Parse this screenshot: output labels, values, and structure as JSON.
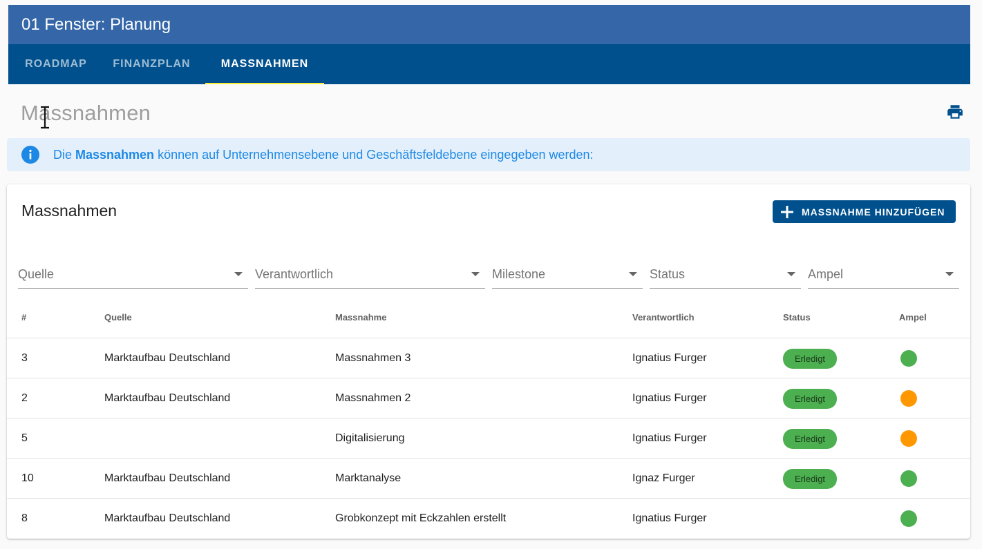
{
  "window": {
    "title": "01 Fenster: Planung"
  },
  "tabs": [
    {
      "label": "ROADMAP"
    },
    {
      "label": "FINANZPLAN"
    },
    {
      "label": "MASSNAHMEN"
    }
  ],
  "page": {
    "title": "Massnahmen"
  },
  "info": {
    "prefix": "Die ",
    "bold": "Massnahmen",
    "suffix": " können auf Unternehmensebene und Geschäftsfeldebene eingegeben werden:"
  },
  "card": {
    "title": "Massnahmen",
    "add_button_label": "MASSNAHME HINZUFÜGEN"
  },
  "filters": [
    {
      "label": "Quelle"
    },
    {
      "label": "Verantwortlich"
    },
    {
      "label": "Milestone"
    },
    {
      "label": "Status"
    },
    {
      "label": "Ampel"
    }
  ],
  "table": {
    "headers": [
      "#",
      "Quelle",
      "Massnahme",
      "Verantwortlich",
      "Status",
      "Ampel"
    ],
    "rows": [
      {
        "nr": "3",
        "quelle": "Marktaufbau Deutschland",
        "massnahme": "Massnahmen 3",
        "verantwortlich": "Ignatius Furger",
        "status": "Erledigt",
        "ampel": "#4caf50"
      },
      {
        "nr": "2",
        "quelle": "Marktaufbau Deutschland",
        "massnahme": "Massnahmen 2",
        "verantwortlich": "Ignatius Furger",
        "status": "Erledigt",
        "ampel": "#ff9800"
      },
      {
        "nr": "5",
        "quelle": "",
        "massnahme": "Digitalisierung",
        "verantwortlich": "Ignatius Furger",
        "status": "Erledigt",
        "ampel": "#ff9800"
      },
      {
        "nr": "10",
        "quelle": "Marktaufbau Deutschland",
        "massnahme": "Marktanalyse",
        "verantwortlich": "Ignaz Furger",
        "status": "Erledigt",
        "ampel": "#4caf50"
      },
      {
        "nr": "8",
        "quelle": "Marktaufbau Deutschland",
        "massnahme": "Grobkonzept mit Eckzahlen erstellt",
        "verantwortlich": "Ignatius Furger",
        "status": "",
        "ampel": "#4caf50"
      }
    ]
  },
  "colors": {
    "header": "#3466a8",
    "tabs": "#00508d",
    "accent": "#ffeb3b",
    "status_done": "#4caf50",
    "ampel_green": "#4caf50",
    "ampel_orange": "#ff9800"
  }
}
